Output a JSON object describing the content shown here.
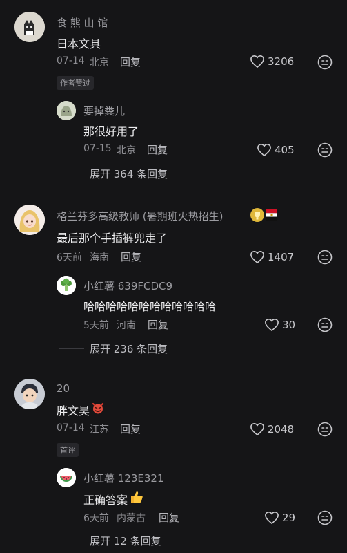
{
  "comments": [
    {
      "name": "食 熊 山 馆",
      "text": "日本文具",
      "date": "07-14",
      "location": "北京",
      "reply_label": "回复",
      "likes": "3206",
      "tag": "作者赞过",
      "replies": [
        {
          "name": "要掉粪儿",
          "text": "那很好用了",
          "date": "07-15",
          "location": "北京",
          "reply_label": "回复",
          "likes": "405"
        }
      ],
      "expand_label": "展开 364 条回复"
    },
    {
      "name": "格兰芬多高级教师 (暑期班火热招生)",
      "text": "最后那个手插裤兜走了",
      "date": "6天前",
      "location": "海南",
      "reply_label": "回复",
      "likes": "1407",
      "replies": [
        {
          "name": "小红薯 639FCDC9",
          "text": "哈哈哈哈哈哈哈哈哈哈哈哈",
          "date": "5天前",
          "location": "河南",
          "reply_label": "回复",
          "likes": "30"
        }
      ],
      "expand_label": "展开 236 条回复"
    },
    {
      "name": "20",
      "text": "胖文昊",
      "date": "07-14",
      "location": "江苏",
      "reply_label": "回复",
      "likes": "2048",
      "tag": "首评",
      "replies": [
        {
          "name": "小红薯 123E321",
          "text": "正确答案",
          "date": "6天前",
          "location": "内蒙古",
          "reply_label": "回复",
          "likes": "29"
        }
      ],
      "expand_label": "展开 12 条回复"
    }
  ],
  "icons": {
    "like": "heart-outline-icon",
    "dislike": "meh-face-icon"
  },
  "colors": {
    "background": "#151517",
    "text": "#ececee",
    "muted": "#8e8e93"
  }
}
